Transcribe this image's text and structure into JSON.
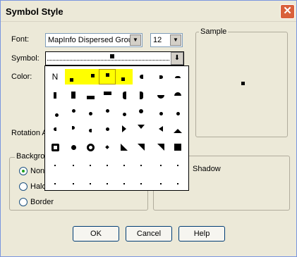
{
  "dialog": {
    "title": "Symbol Style"
  },
  "font": {
    "label": "Font:",
    "value": "MapInfo Dispersed Group",
    "size": "12"
  },
  "symbol": {
    "label": "Symbol:"
  },
  "color": {
    "label": "Color:"
  },
  "rotation": {
    "label": "Rotation A"
  },
  "background": {
    "group_label": "Backgro",
    "options": [
      "Non",
      "Halo",
      "Border"
    ],
    "selected": 0
  },
  "shadow": {
    "label": "Shadow"
  },
  "sample": {
    "label": "Sample"
  },
  "symbol_grid": {
    "first_cell_text": "N",
    "highlighted_count": 4,
    "selected_cell": "row 1, column 4"
  },
  "buttons": {
    "ok": "OK",
    "cancel": "Cancel",
    "help": "Help"
  },
  "colors": {
    "window_bg": "#ece9d8",
    "highlight": "#ffff00",
    "close_red": "#d9603b"
  }
}
